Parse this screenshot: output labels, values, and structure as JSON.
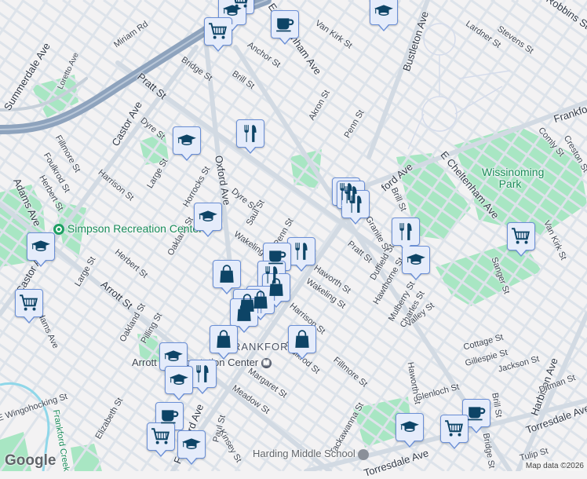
{
  "map": {
    "colors": {
      "background": "#f3f2f3",
      "road": "#d6dde5",
      "highway": "#8ea3bd",
      "park": "#a8e6c3",
      "marker_fill": "#e5ecfb",
      "marker_border": "#6a8fd6",
      "icon": "#0d4466"
    },
    "streets": [
      "Miriam Rd",
      "Loretto Ave",
      "Summerdale Ave",
      "Pratt St",
      "Bridge St",
      "Brill St",
      "Anchor St",
      "Van Kirk St",
      "Castor Ave",
      "Dyre St",
      "Large St",
      "Horrocks St",
      "Oxford Ave",
      "Fillmore St",
      "Foulkrod St",
      "Herbert St",
      "Adams Ave",
      "Harrison St",
      "Dyre St",
      "Saul St",
      "Akron St",
      "Penn St",
      "Bustleton Ave",
      "Lardner St",
      "Stevens St",
      "Robbins St",
      "Frankford Ave",
      "Comly St",
      "Creston St",
      "E Cheltenham Ave",
      "ford Ave",
      "Brill St",
      "Arrott St",
      "Herbert St",
      "Oakland St",
      "Oakland St",
      "Large St",
      "Castor Ave",
      "Adams Ave",
      "Pilling St",
      "Margaret St",
      "Meadow St",
      "E Wingohocking St",
      "Elizabeth St",
      "Paul St",
      "Kinsey St",
      "Haworth St",
      "Wakeling St",
      "Duffield St",
      "Hawthorne St",
      "Mulberry St",
      "Charles St",
      "Valley St",
      "Haworth St",
      "Cottage St",
      "Gillespie St",
      "Jackson St",
      "Fillmore St",
      "Tackawanna St",
      "Glenloch St",
      "Harbison Ave",
      "Ditman St",
      "Torresdale Ave",
      "Tulip St",
      "Bridge St",
      "Brill St",
      "Sanger St",
      "Van Kirk St",
      "Wakeling St",
      "Penn St",
      "Harrison St",
      "Foulkrod St",
      "Pratt St",
      "Granite St",
      "E Cheltenham Ave",
      "Torresdale Ave",
      "Frankford Ave",
      "Frankford Creek"
    ],
    "places": {
      "simpson": "Simpson Recreation Center",
      "wissinoming": "Wissinoming Park",
      "arrott": "Arrott Transportation Center",
      "frankford": "FRANKFORD",
      "harding": "Harding Middle School",
      "metro": "M"
    },
    "markers": [
      "school",
      "coffee",
      "cart",
      "school",
      "cart",
      "restaurant",
      "school",
      "school",
      "school",
      "cart",
      "bag",
      "restaurant",
      "coffee",
      "restaurant",
      "bag",
      "bag",
      "bag",
      "bag",
      "bag",
      "bag",
      "restaurant",
      "restaurant",
      "restaurant",
      "restaurant",
      "school",
      "cart",
      "school",
      "restaurant",
      "school",
      "coffee",
      "cart",
      "school",
      "school",
      "cart",
      "coffee"
    ],
    "google_logo": "Google",
    "attribution": "Map data ©2026"
  }
}
